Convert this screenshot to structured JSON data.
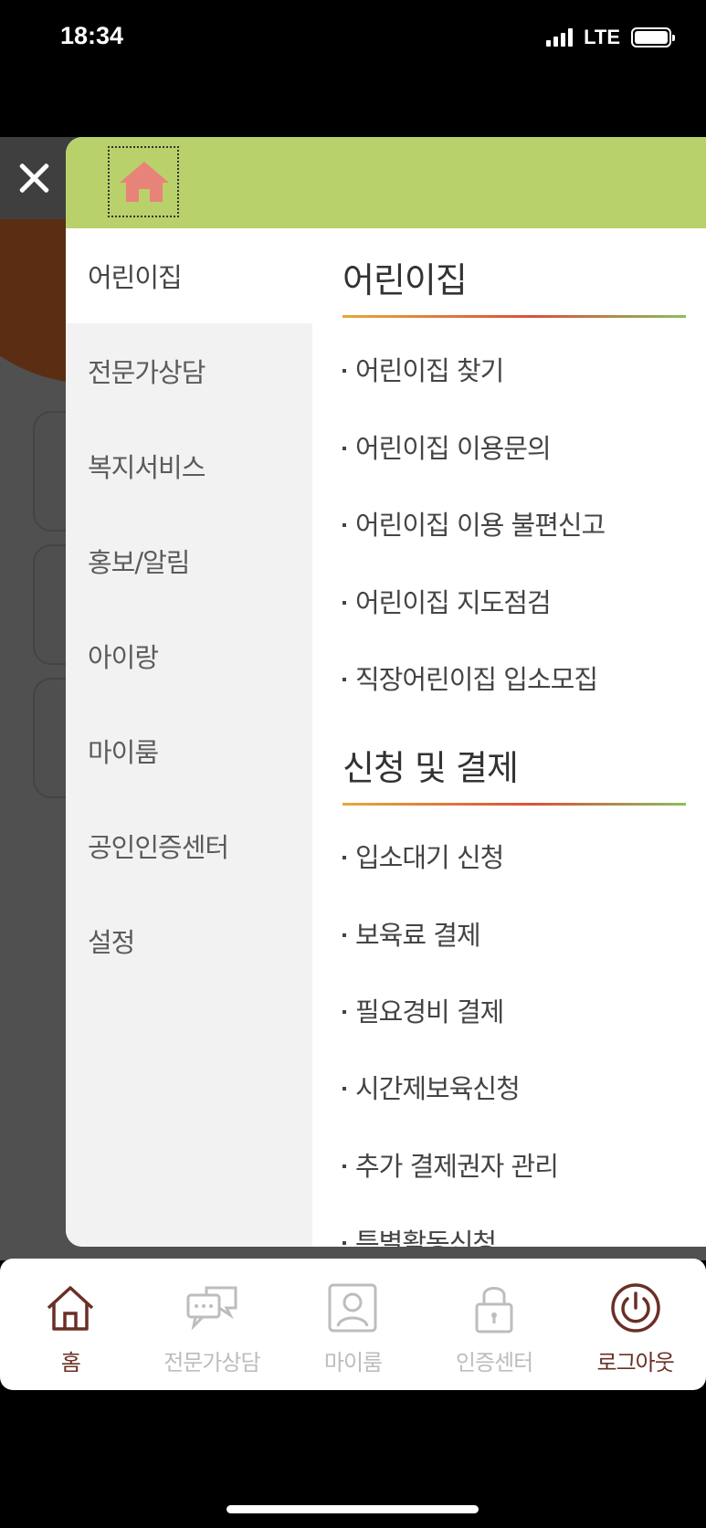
{
  "status": {
    "time": "18:34",
    "network": "LTE"
  },
  "drawer": {
    "left_menu": [
      {
        "label": "어린이집",
        "active": true
      },
      {
        "label": "전문가상담"
      },
      {
        "label": "복지서비스"
      },
      {
        "label": "홍보/알림"
      },
      {
        "label": "아이랑"
      },
      {
        "label": "마이룸"
      },
      {
        "label": "공인인증센터"
      },
      {
        "label": "설정"
      }
    ],
    "sections": [
      {
        "title": "어린이집",
        "items": [
          "어린이집 찾기",
          "어린이집 이용문의",
          "어린이집 이용 불편신고",
          "어린이집 지도점검",
          "직장어린이집 입소모집"
        ]
      },
      {
        "title": "신청 및 결제",
        "items": [
          "입소대기 신청",
          "보육료 결제",
          "필요경비 결제",
          "시간제보육신청",
          "추가 결제권자 관리",
          "특별활동신청"
        ]
      }
    ]
  },
  "bottom_nav": [
    {
      "label": "홈",
      "icon": "home-icon"
    },
    {
      "label": "전문가상담",
      "icon": "chat-icon"
    },
    {
      "label": "마이룸",
      "icon": "person-icon"
    },
    {
      "label": "인증센터",
      "icon": "lock-icon"
    },
    {
      "label": "로그아웃",
      "icon": "power-icon"
    }
  ],
  "colors": {
    "header_green": "#b9d16a",
    "home_icon": "#e8837a",
    "nav_active": "#6a2f25",
    "nav_inactive": "#bdbdbd"
  }
}
